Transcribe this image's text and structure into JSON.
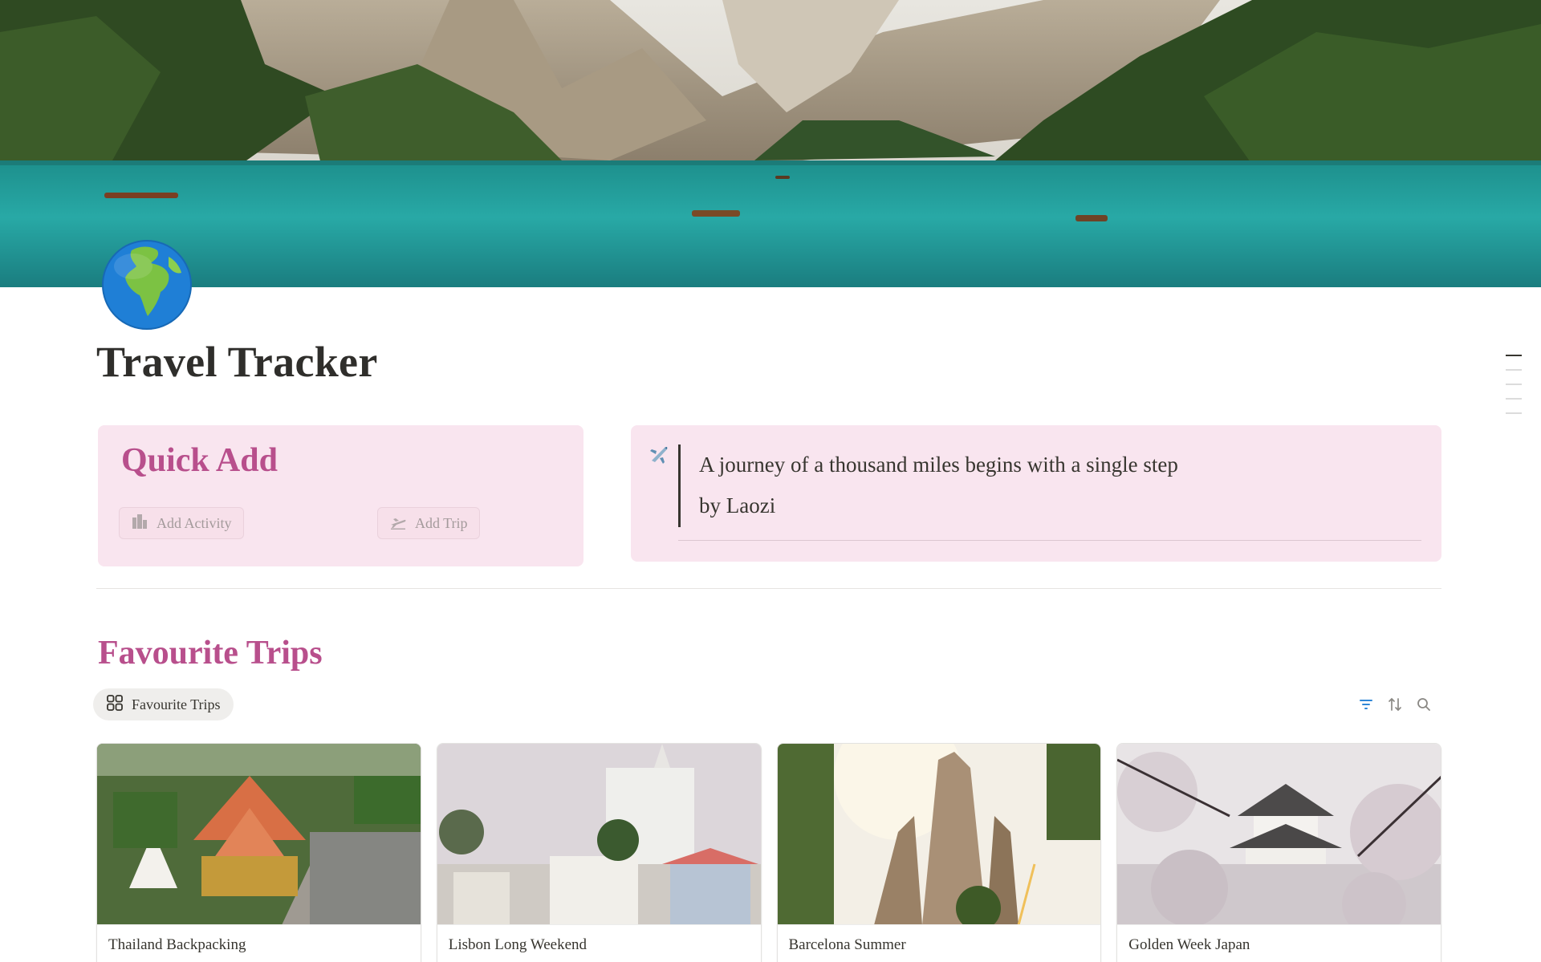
{
  "page": {
    "title": "Travel Tracker",
    "icon": "globe-europe-africa-icon"
  },
  "quick_add": {
    "title": "Quick Add",
    "buttons": [
      {
        "label": "Add Activity",
        "icon": "city-icon"
      },
      {
        "label": "Add Trip",
        "icon": "airplane-departure-icon"
      }
    ]
  },
  "quote": {
    "icon": "airplane-icon",
    "text": "A journey of a thousand miles begins with a single step",
    "author": "by Laozi"
  },
  "favourites": {
    "heading": "Favourite Trips",
    "view_tab": {
      "label": "Favourite Trips",
      "icon": "gallery-grid-icon"
    },
    "toolbar": [
      "filter-icon",
      "sort-icon",
      "search-icon"
    ],
    "cards": [
      {
        "name": "Thailand Backpacking"
      },
      {
        "name": "Lisbon Long Weekend"
      },
      {
        "name": "Barcelona Summer"
      },
      {
        "name": "Golden Week Japan"
      }
    ]
  },
  "colors": {
    "accent": "#b84f8c",
    "callout_bg": "#f9e5ef",
    "text": "#37352f",
    "filter_icon": "#2f86d6"
  }
}
